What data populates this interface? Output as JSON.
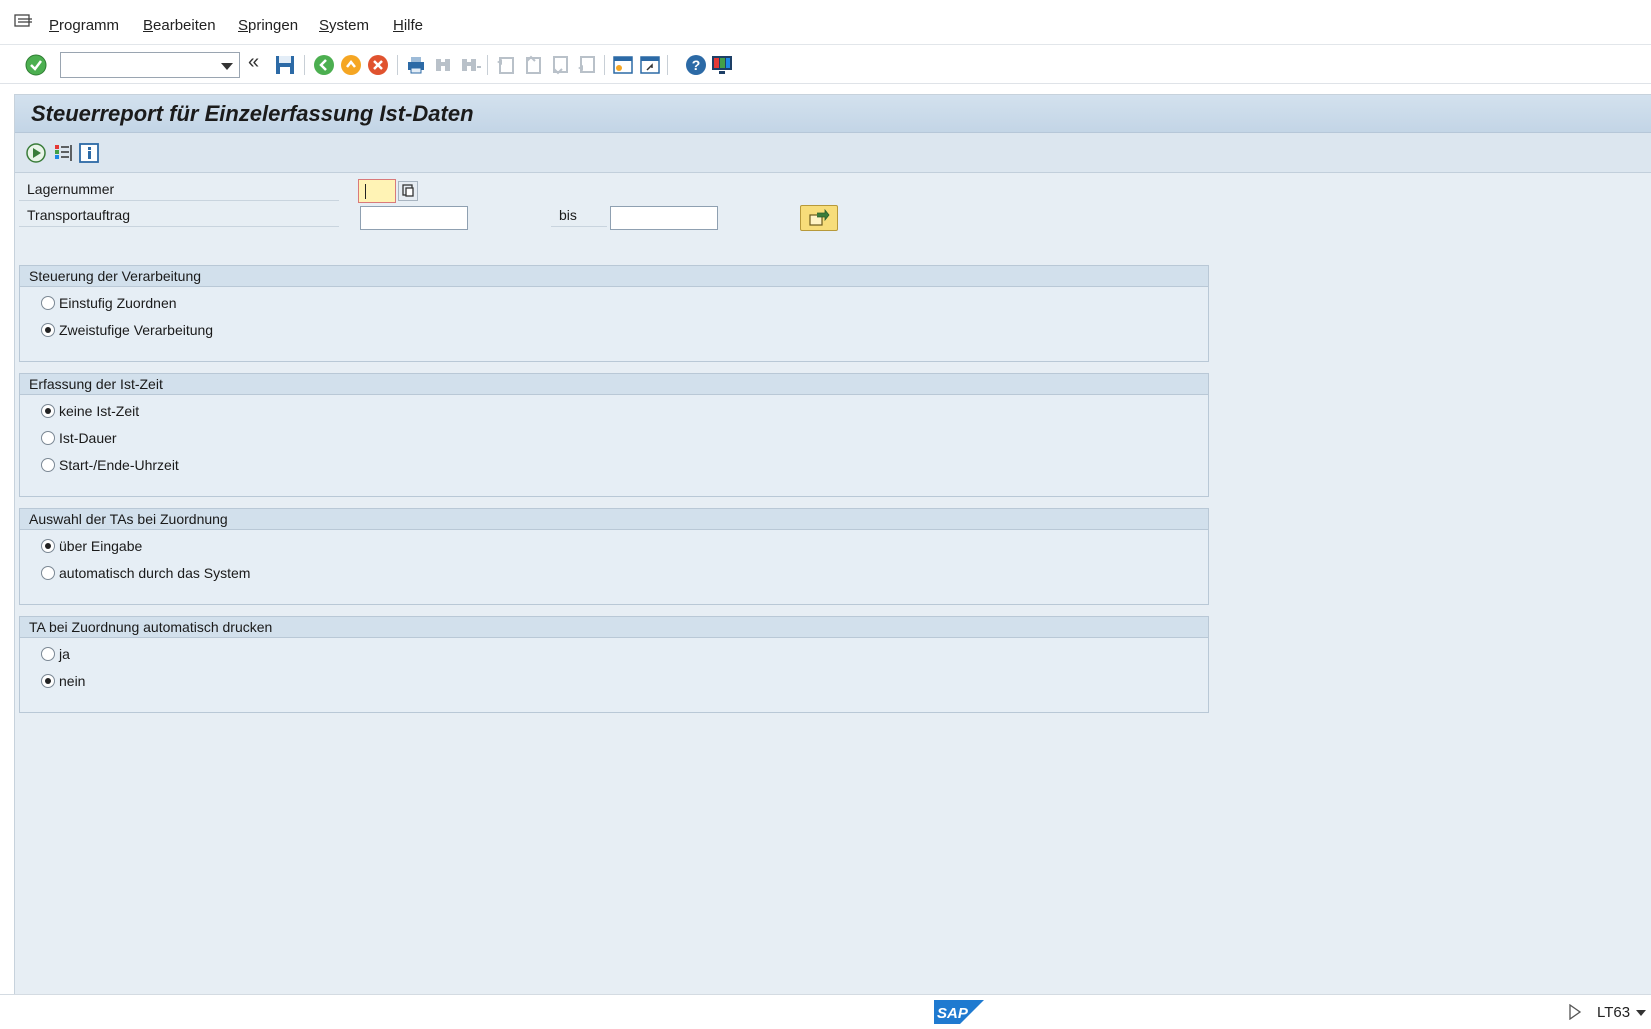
{
  "menu": {
    "items": [
      {
        "label": "Programm",
        "underline": "P",
        "rest": "rogramm"
      },
      {
        "label": "Bearbeiten",
        "underline": "B",
        "rest": "earbeiten"
      },
      {
        "label": "Springen",
        "underline": "S",
        "rest": "pringen"
      },
      {
        "label": "System",
        "underline": "S",
        "rest": "ystem"
      },
      {
        "label": "Hilfe",
        "underline": "H",
        "rest": "ilfe"
      }
    ]
  },
  "toolbar": {
    "command_value": "",
    "icons": [
      "enter-icon",
      "save-icon",
      "back-icon",
      "exit-icon",
      "cancel-icon",
      "print-icon",
      "find-icon",
      "find-next-icon",
      "first-page-icon",
      "previous-page-icon",
      "next-page-icon",
      "last-page-icon",
      "new-session-icon",
      "shortcut-icon",
      "help-icon",
      "customize-layout-icon"
    ]
  },
  "screen": {
    "title": "Steuerreport für Einzelerfassung Ist-Daten",
    "app_icons": [
      "execute-icon",
      "get-variant-icon",
      "info-icon"
    ]
  },
  "fields": {
    "lagernummer_label": "Lagernummer",
    "lagernummer_value": "",
    "transportauftrag_label": "Transportauftrag",
    "transportauftrag_from": "",
    "bis_label": "bis",
    "transportauftrag_to": ""
  },
  "groups": {
    "steuerung": {
      "title": "Steuerung der Verarbeitung",
      "options": [
        {
          "label": "Einstufig Zuordnen",
          "selected": false
        },
        {
          "label": "Zweistufige Verarbeitung",
          "selected": true
        }
      ]
    },
    "istzeit": {
      "title": "Erfassung der Ist-Zeit",
      "options": [
        {
          "label": "keine Ist-Zeit",
          "selected": true
        },
        {
          "label": "Ist-Dauer",
          "selected": false
        },
        {
          "label": "Start-/Ende-Uhrzeit",
          "selected": false
        }
      ]
    },
    "auswahl": {
      "title": "Auswahl der TAs bei Zuordnung",
      "options": [
        {
          "label": "über Eingabe",
          "selected": true
        },
        {
          "label": "automatisch durch das System",
          "selected": false
        }
      ]
    },
    "drucken": {
      "title": "TA bei Zuordnung automatisch drucken",
      "options": [
        {
          "label": "ja",
          "selected": false
        },
        {
          "label": "nein",
          "selected": true
        }
      ]
    }
  },
  "status": {
    "logo_text": "SAP",
    "transaction": "LT63"
  },
  "colors": {
    "background": "#e7eef4",
    "title_band": "#c3d5e6",
    "required_field": "#fff3b5",
    "execute_button": "#f7dd7a"
  }
}
